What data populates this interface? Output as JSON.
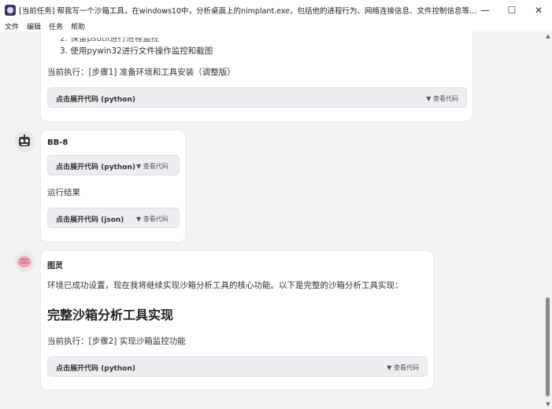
{
  "window": {
    "title": "[当前任务] 帮我写一个沙箱工具，在windows10中，分析桌面上的nimplant.exe，包括他的进程行为、网络连接信息、文件控制信息等，尤其是网络部分，...",
    "minimize": "—",
    "maximize": "☐",
    "close": "✕"
  },
  "menu": [
    "文件",
    "编辑",
    "任务",
    "帮助"
  ],
  "message1": {
    "list_item_2": "2. 保留psutil进行进程监控",
    "list_item_3": "3. 使用pywin32进行文件操作监控和截图",
    "current_step": "当前执行：[步骤1] 准备环境和工具安装（调整版）",
    "code_label": "点击展开代码 (python)",
    "code_toggle": "▼ 查看代码"
  },
  "message2": {
    "sender": "BB-8",
    "code1_label": "点击展开代码 (python)",
    "code1_toggle": "▼ 查看代码",
    "result_label": "运行结果",
    "code2_label": "点击展开代码 (json)",
    "code2_toggle": "▼ 查看代码"
  },
  "message3": {
    "sender": "图灵",
    "intro": "环境已成功设置，现在我将继续实现沙箱分析工具的核心功能。以下是完整的沙箱分析工具实现：",
    "heading": "完整沙箱分析工具实现",
    "current_step": "当前执行：[步骤2] 实现沙箱监控功能",
    "code_label": "点击展开代码 (python)",
    "code_toggle": "▼ 查看代码"
  },
  "scrollbar": {
    "up": "▲",
    "down": "▼"
  },
  "colors": {
    "card_bg": "#ffffff",
    "page_bg": "#f2f2f2",
    "code_bg": "#eceef2"
  },
  "icons": [
    "app-icon",
    "robot-avatar-icon",
    "brain-avatar-icon"
  ]
}
